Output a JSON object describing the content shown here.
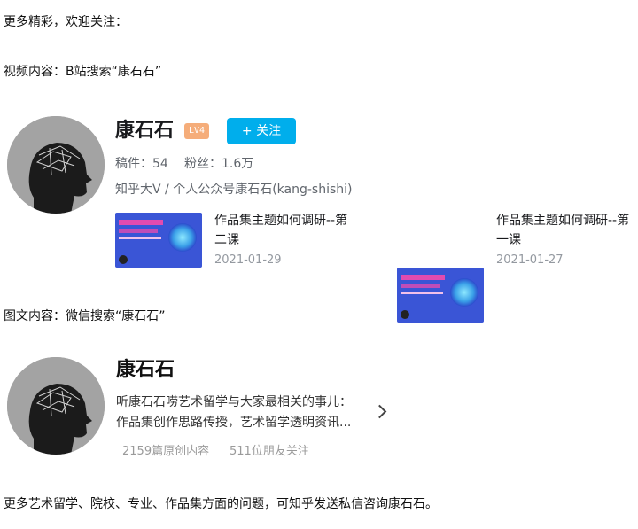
{
  "intro": {
    "more": "更多精彩，欢迎关注：",
    "video_label": "视频内容：B站搜索“康石石”"
  },
  "bili": {
    "name": "康石石",
    "level": "LV4",
    "follow_label": "+ 关注",
    "posts_label": "稿件：",
    "posts_value": "54",
    "fans_label": "粉丝：",
    "fans_value": "1.6万",
    "description": "知乎大V / 个人公众号康石石(kang-shishi)",
    "videos": [
      {
        "title_line1": "作品集主题如何调研--第",
        "title_line2": "二课",
        "date": "2021-01-29"
      },
      {
        "title_line1": "作品集主题如何调研--第",
        "title_line2": "一课",
        "date": "2021-01-27"
      }
    ]
  },
  "graphic_label": "图文内容：微信搜索“康石石”",
  "wechat": {
    "name": "康石石",
    "desc_line1": "听康石石唠艺术留学与大家最相关的事儿：",
    "desc_line2": "作品集创作思路传授，艺术留学透明资讯...",
    "original_count": "2159篇原创内容",
    "friends_follow": "511位朋友关注"
  },
  "footer": "更多艺术留学、院校、专业、作品集方面的问题，可知乎发送私信咨询康石石。",
  "colors": {
    "follow_button": "#00aeec",
    "level_badge": "#f5ad7a",
    "thumb_bg": "#3a55d6"
  },
  "icons": [
    "avatar-head-icon",
    "chevron-right-icon"
  ]
}
